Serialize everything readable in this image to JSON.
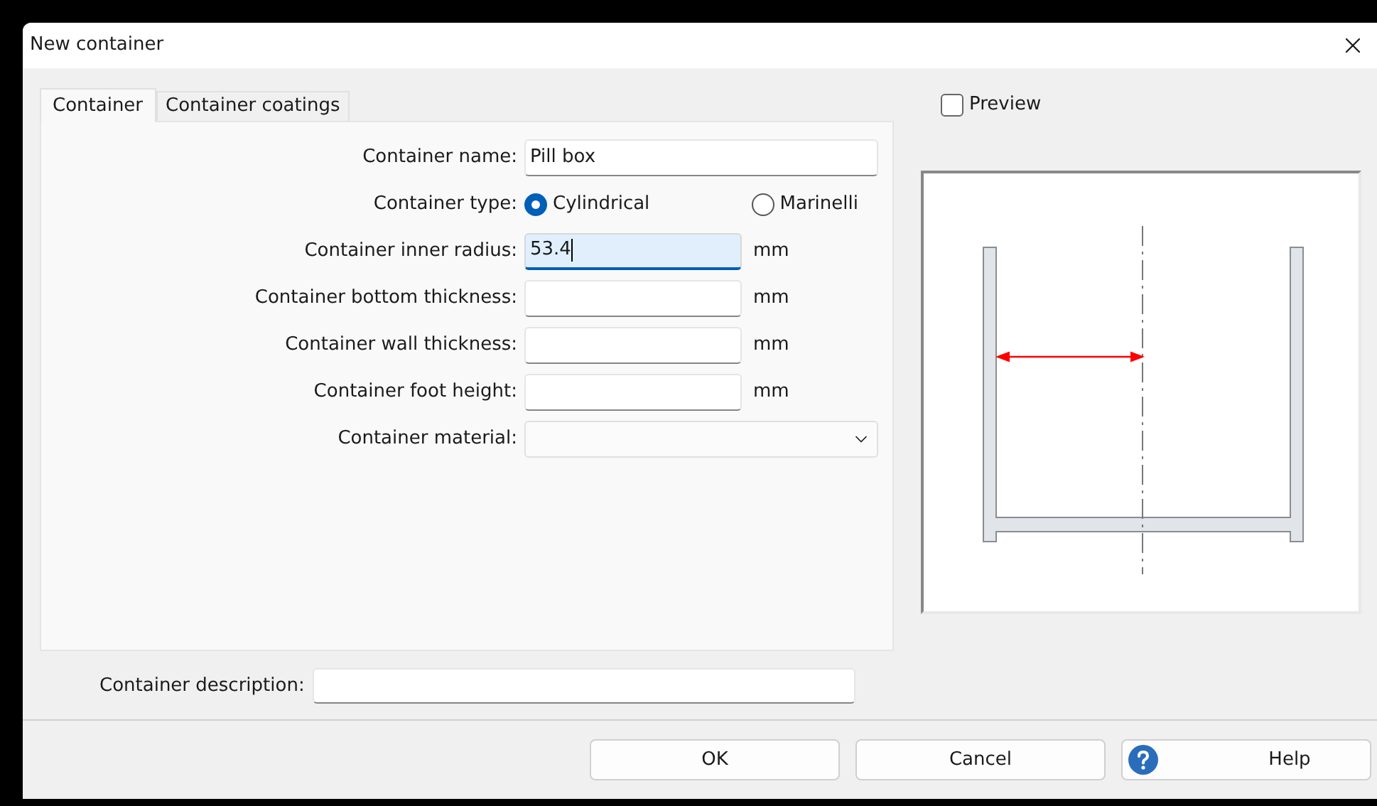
{
  "window": {
    "title": "New container"
  },
  "tabs": [
    {
      "label": "Container",
      "selected": true
    },
    {
      "label": "Container coatings",
      "selected": false
    }
  ],
  "fields": [
    {
      "kind": "text",
      "label": "Container name:",
      "value": "Pill box",
      "focused": false
    },
    {
      "kind": "radio",
      "label": "Container type:",
      "options": [
        {
          "label": "Cylindrical",
          "selected": true
        },
        {
          "label": "Marinelli",
          "selected": false
        }
      ]
    },
    {
      "kind": "text",
      "label": "Container inner radius:",
      "value": "53.4",
      "unit": "mm",
      "focused": true
    },
    {
      "kind": "text",
      "label": "Container bottom thickness:",
      "unit": "mm",
      "focused": false
    },
    {
      "kind": "text",
      "label": "Container wall thickness:",
      "unit": "mm",
      "focused": false
    },
    {
      "kind": "text",
      "label": "Container foot height:",
      "unit": "mm",
      "focused": false
    },
    {
      "kind": "select",
      "label": "Container material:"
    }
  ],
  "preview": {
    "label": "Preview",
    "checked": false
  },
  "description": {
    "label": "Container description:"
  },
  "buttons": [
    {
      "label": "OK",
      "kind": "plain"
    },
    {
      "label": "Cancel",
      "kind": "plain"
    },
    {
      "label": "Help",
      "kind": "help"
    }
  ]
}
